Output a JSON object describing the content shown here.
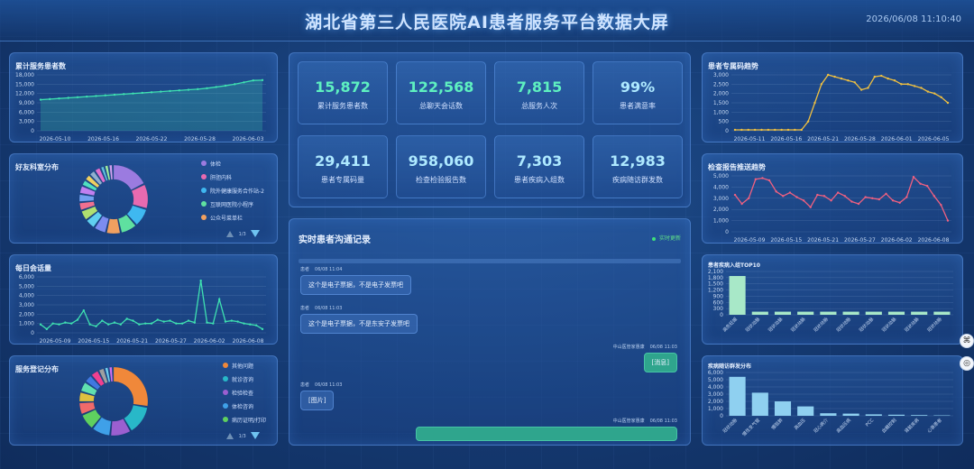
{
  "header": {
    "title": "湖北省第三人民医院AI患者服务平台数据大屏",
    "clock": "2026/06/08 11:10:40"
  },
  "panels": {
    "cumulative": {
      "title": "累计服务患者数"
    },
    "dept": {
      "title": "好友科室分布",
      "pager": "1/3"
    },
    "daily": {
      "title": "每日会话量"
    },
    "register": {
      "title": "服务登记分布"
    },
    "qrcode": {
      "title": "患者专属码趋势"
    },
    "report": {
      "title": "检查报告推送趋势"
    },
    "groupTop": {
      "title": "患者疾病入组TOP10"
    },
    "followup": {
      "title": "疾病随访群发分布"
    }
  },
  "stats": [
    {
      "value": "15,872",
      "label": "累计服务患者数",
      "color": "#5ef0c0"
    },
    {
      "value": "122,568",
      "label": "总聊天会话数",
      "color": "#5ef0c0"
    },
    {
      "value": "7,815",
      "label": "总服务人次",
      "color": "#5ef0c0"
    },
    {
      "value": "99%",
      "label": "患者满意率",
      "color": "#aee9ff"
    },
    {
      "value": "29,411",
      "label": "患者专属码量",
      "color": "#aee9ff"
    },
    {
      "value": "958,060",
      "label": "检查检验报告数",
      "color": "#aee9ff"
    },
    {
      "value": "7,303",
      "label": "患者疾病入组数",
      "color": "#aee9ff"
    },
    {
      "value": "12,983",
      "label": "疾病随访群发数",
      "color": "#aee9ff"
    }
  ],
  "chat": {
    "title": "实时患者沟通记录",
    "live": "实时更新",
    "messages": [
      {
        "side": "left",
        "sender": "患者",
        "time": "06/08 11:04",
        "text": "这个是电子票据，不是电子发票吧"
      },
      {
        "side": "left",
        "sender": "患者",
        "time": "06/08 11:03",
        "text": "这个是电子票据，不是东安子发票吧"
      },
      {
        "side": "right",
        "sender": "中山医管家惠康",
        "time": "06/08 11:03",
        "text": "[消息]"
      },
      {
        "side": "left",
        "sender": "患者",
        "time": "06/08 11:03",
        "text": "[图片]"
      },
      {
        "side": "right",
        "sender": "中山医管家惠康",
        "time": "06/08 11:03",
        "text": ""
      }
    ]
  },
  "dept_legend": [
    {
      "label": "体检",
      "color": "#9b7be0"
    },
    {
      "label": "肝胆内科",
      "color": "#e86ab0"
    },
    {
      "label": "院外健康服务合作站-2",
      "color": "#3fb8f0"
    },
    {
      "label": "互联网医院小程序",
      "color": "#5fe0a0"
    },
    {
      "label": "公众号菜单栏",
      "color": "#f0a060"
    }
  ],
  "register_legend": [
    {
      "label": "其他问题",
      "color": "#f0883a"
    },
    {
      "label": "就诊咨询",
      "color": "#28b8c8"
    },
    {
      "label": "检验检查",
      "color": "#9b5fd0"
    },
    {
      "label": "体检咨询",
      "color": "#3fa0e8"
    },
    {
      "label": "病历证明/打印",
      "color": "#5fd05f"
    }
  ],
  "register_pager": "1/3",
  "chart_data": [
    {
      "type": "area",
      "title": "累计服务患者数",
      "x": [
        "2026-05-10",
        "2026-05-16",
        "2026-05-22",
        "2026-05-28",
        "2026-06-03"
      ],
      "yticks": [
        0,
        3000,
        6000,
        9000,
        12000,
        15000,
        18000
      ],
      "ylim": [
        0,
        18000
      ],
      "values": [
        10000,
        10200,
        10400,
        10600,
        10800,
        11000,
        11200,
        11400,
        11600,
        11800,
        12000,
        12200,
        12400,
        12600,
        12800,
        13000,
        13200,
        13400,
        13700,
        14100,
        14500,
        15000,
        15600,
        16200,
        16300
      ],
      "color": "#3ee0b0"
    },
    {
      "type": "line",
      "title": "每日会话量",
      "x": [
        "2026-05-09",
        "2026-05-15",
        "2026-05-21",
        "2026-05-27",
        "2026-06-02",
        "2026-06-08"
      ],
      "yticks": [
        0,
        1000,
        2000,
        3000,
        4000,
        5000,
        6000
      ],
      "ylim": [
        0,
        6000
      ],
      "values": [
        900,
        400,
        1000,
        900,
        1100,
        1000,
        1400,
        2400,
        900,
        700,
        1300,
        900,
        1100,
        900,
        1500,
        1300,
        900,
        1000,
        1000,
        1400,
        1200,
        1300,
        1000,
        1000,
        1300,
        1100,
        5600,
        1100,
        1000,
        3600,
        1200,
        1300,
        1200,
        1000,
        900,
        800,
        400
      ],
      "color": "#3ee0b0"
    },
    {
      "type": "line",
      "title": "患者专属码趋势",
      "x": [
        "2026-05-11",
        "2026-05-16",
        "2026-05-21",
        "2026-05-28",
        "2026-06-01",
        "2026-06-05"
      ],
      "yticks": [
        0,
        500,
        1000,
        1500,
        2000,
        2500,
        3000
      ],
      "ylim": [
        0,
        3000
      ],
      "values": [
        50,
        50,
        50,
        50,
        50,
        50,
        50,
        50,
        50,
        50,
        50,
        500,
        1500,
        2500,
        3000,
        2900,
        2800,
        2700,
        2600,
        2200,
        2300,
        2900,
        2950,
        2800,
        2700,
        2500,
        2500,
        2400,
        2300,
        2100,
        2000,
        1800,
        1500
      ],
      "color": "#f0c040"
    },
    {
      "type": "line",
      "title": "检查报告推送趋势",
      "x": [
        "2026-05-09",
        "2026-05-15",
        "2026-05-21",
        "2026-05-27",
        "2026-06-02",
        "2026-06-08"
      ],
      "yticks": [
        0,
        1000,
        2000,
        3000,
        4000,
        5000
      ],
      "ylim": [
        0,
        5000
      ],
      "values": [
        3300,
        2500,
        3000,
        4700,
        4800,
        4600,
        3600,
        3200,
        3500,
        3100,
        2800,
        2200,
        3300,
        3200,
        2800,
        3500,
        3200,
        2700,
        2500,
        3100,
        3000,
        2900,
        3400,
        2800,
        2600,
        3100,
        4900,
        4300,
        4100,
        3200,
        2400,
        1000
      ],
      "color": "#f06080"
    },
    {
      "type": "bar",
      "title": "患者疾病入组TOP10",
      "categories": [
        "高危妊娠",
        "冠状动脉",
        "冠状动脉",
        "冠状动脉",
        "冠状动脉",
        "冠状动脉",
        "冠状动脉",
        "冠状动脉",
        "冠状动脉",
        "冠状动脉"
      ],
      "yticks": [
        0,
        300,
        600,
        900,
        1200,
        1500,
        1800,
        2100
      ],
      "ylim": [
        0,
        2100
      ],
      "values": [
        1880,
        150,
        150,
        150,
        150,
        150,
        150,
        150,
        150,
        150
      ],
      "color": "#a8e8c8"
    },
    {
      "type": "bar",
      "title": "疾病随访群发分布",
      "categories": [
        "冠状动脉",
        "慢性支气管",
        "慢阻肺",
        "高血压",
        "冠心病介",
        "高血压病",
        "PCC",
        "血糖控制",
        "肾脏疾病",
        "心衰患者"
      ],
      "yticks": [
        0,
        1000,
        2000,
        3000,
        4000,
        5000,
        6000
      ],
      "ylim": [
        0,
        6000
      ],
      "values": [
        5400,
        3200,
        2000,
        1300,
        350,
        300,
        200,
        150,
        100,
        60
      ],
      "color": "#8fd0f0"
    },
    {
      "type": "pie",
      "title": "好友科室分布",
      "values": [
        18,
        12,
        9,
        8,
        7,
        6,
        5,
        5,
        4,
        4,
        4,
        3,
        3,
        3,
        3,
        2,
        2,
        2
      ],
      "colors": [
        "#9b7be0",
        "#e86ab0",
        "#3fb8f0",
        "#5fe0a0",
        "#f0a060",
        "#7c8cf0",
        "#60d0f0",
        "#b0e070",
        "#f07090",
        "#70a0f0",
        "#c080f0",
        "#50e0c0",
        "#f0d060",
        "#90b0d0",
        "#e070d0",
        "#60c0e0",
        "#a0f0a0",
        "#d0a0f0"
      ]
    },
    {
      "type": "pie",
      "title": "服务登记分布",
      "values": [
        28,
        14,
        10,
        9,
        8,
        6,
        5,
        5,
        4,
        4,
        3,
        2,
        2
      ],
      "colors": [
        "#f0883a",
        "#28b8c8",
        "#9b5fd0",
        "#3fa0e8",
        "#5fd05f",
        "#f06a6a",
        "#e0c040",
        "#60e0b0",
        "#4078e0",
        "#f04090",
        "#a0a0a0",
        "#70d0f0",
        "#d070f0"
      ]
    }
  ]
}
